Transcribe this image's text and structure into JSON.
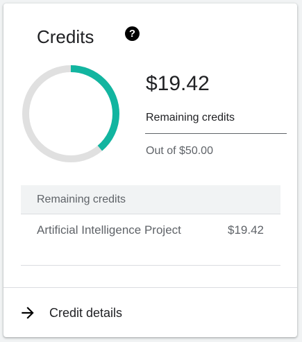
{
  "card": {
    "title": "Credits",
    "help_icon": "help-circle-icon",
    "help_icon_glyph": "?"
  },
  "summary": {
    "amount": "$19.42",
    "remaining_label": "Remaining credits",
    "out_of": "Out of $50.00",
    "remaining_value": 19.42,
    "total_value": 50.0,
    "accent_color": "#12b5a0",
    "track_color": "#e0e0e0"
  },
  "table": {
    "header": "Remaining credits",
    "rows": [
      {
        "name": "Artificial Intelligence Project",
        "value": "$19.42"
      }
    ]
  },
  "footer": {
    "icon": "arrow-right-icon",
    "label": "Credit details"
  }
}
